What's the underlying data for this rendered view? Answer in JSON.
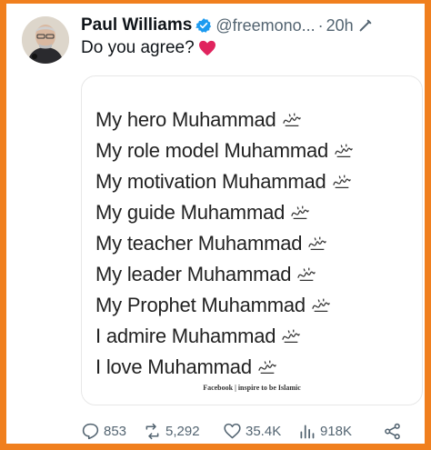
{
  "tweet": {
    "author_name": "Paul Williams",
    "handle": "@freemono...",
    "separator": "·",
    "time": "20h",
    "text": "Do you agree?"
  },
  "card": {
    "lines": [
      "My hero Muhammad",
      "My role model Muhammad",
      "My motivation Muhammad",
      "My guide Muhammad",
      "My teacher Muhammad",
      "My leader Muhammad",
      "My Prophet Muhammad",
      "I admire Muhammad",
      "I love Muhammad"
    ],
    "credit": "Facebook | inspire to be Islamic"
  },
  "actions": {
    "replies": "853",
    "reposts": "5,292",
    "likes": "35.4K",
    "views": "918K"
  },
  "icons": [
    "verified-badge-icon",
    "grok-icon",
    "heart-emoji-icon",
    "pbuh-calligraphy-icon",
    "reply-icon",
    "repost-icon",
    "like-icon",
    "views-icon",
    "share-icon"
  ],
  "colors": {
    "frame": "#f07f1e",
    "verified": "#1d9bf0",
    "heart": "#e0245e",
    "muted": "#536471"
  }
}
